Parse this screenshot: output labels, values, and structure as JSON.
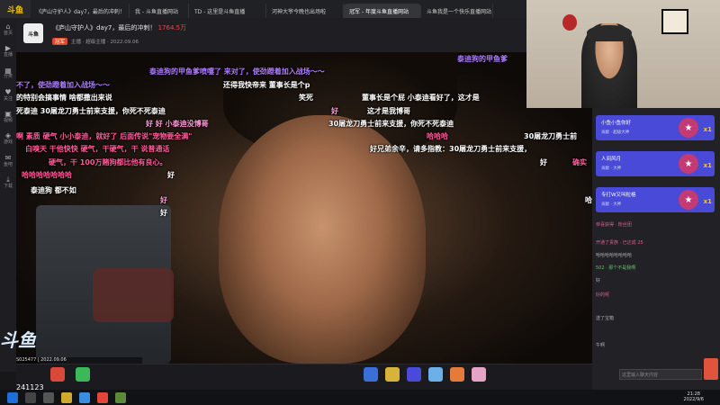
{
  "tabs": [
    {
      "label": "斗鱼",
      "active": false
    },
    {
      "label": "《庐山守护人》day7，最后的冲刺！",
      "active": false
    },
    {
      "label": "我 - 斗鱼直播网站",
      "active": false
    },
    {
      "label": "TD - 这里是斗鱼直播",
      "active": false
    },
    {
      "label": "河神大爷今晚也出场啦",
      "active": false
    },
    {
      "label": "冠军 - 年度斗鱼直播网站",
      "active": true
    },
    {
      "label": "斗鱼我是一个快乐直播网站",
      "active": false
    }
  ],
  "sidebar": {
    "items": [
      {
        "label": "斗鱼",
        "icon": "logo-icon"
      },
      {
        "label": "首页",
        "icon": "home-icon"
      },
      {
        "label": "直播",
        "icon": "live-icon"
      },
      {
        "label": "分类",
        "icon": "category-icon"
      },
      {
        "label": "关注",
        "icon": "follow-icon"
      },
      {
        "label": "视频",
        "icon": "video-icon"
      },
      {
        "label": "游戏",
        "icon": "game-icon"
      },
      {
        "label": "鱼吧",
        "icon": "fishbar-icon"
      },
      {
        "label": "下载",
        "icon": "download-icon"
      }
    ]
  },
  "room": {
    "avatar_text": "斗鱼",
    "title": "《庐山守护人》day7，最后的冲刺！",
    "hot_value": "1764.5万",
    "rank_badge": "冠军",
    "subinfo": "主播 · 超级主播 · 2022.09.06"
  },
  "danmu": [
    {
      "text": "泰迪狗的甲鱼爹喷嚏了 来对了，使劲蹬着加入战场～～",
      "color": "#b07cff"
    },
    {
      "text": "泰迪狗的甲鱼爹",
      "color": "#b07cff"
    },
    {
      "text": "不了，使劲蹬着加入战场～～",
      "color": "#b07cff"
    },
    {
      "text": "还得我快帝来  董事长是个p",
      "color": "#ffffff"
    },
    {
      "text": "的特别会搞事情  啥都撒出来说",
      "color": "#ffffff"
    },
    {
      "text": "笑死",
      "color": "#ffffff"
    },
    {
      "text": "董事长是个屁  小泰迪看好了，这才是",
      "color": "#ffffff"
    },
    {
      "text": "死泰迪   30屠龙刀勇士前来支援，你死不死泰迪",
      "color": "#ffffff"
    },
    {
      "text": "好",
      "color": "#ff9ad8"
    },
    {
      "text": "这才是我博哥",
      "color": "#ffffff"
    },
    {
      "text": "好  好  小泰迪没博哥",
      "color": "#ff9ad8"
    },
    {
      "text": "30屠龙刀勇士前来支援，你死不死泰迪",
      "color": "#ffffff"
    },
    {
      "text": "啊      素质        硬气   小小泰迪，就好了  后面传说\"宠物要全满\"",
      "color": "#ff5a9a"
    },
    {
      "text": "哈哈哈",
      "color": "#ff5a9a"
    },
    {
      "text": "30屠龙刀勇士前",
      "color": "#ffffff"
    },
    {
      "text": "白嗅天       干他快快        硬气，干硬气，干  说普通话",
      "color": "#ff5a9a"
    },
    {
      "text": "好兄弟余辛，请多指教：30屠龙刀勇士前来支援，",
      "color": "#ffffff"
    },
    {
      "text": "硬气，干  100万赌狗都比他有良心。",
      "color": "#ff5a9a"
    },
    {
      "text": "好",
      "color": "#ffffff"
    },
    {
      "text": "确实",
      "color": "#ff5a9a"
    },
    {
      "text": "哈哈哈哈哈哈哈",
      "color": "#ff5a9a"
    },
    {
      "text": "好",
      "color": "#ffffff"
    },
    {
      "text": "泰迪狗  都不如",
      "color": "#ffffff"
    },
    {
      "text": "好",
      "color": "#ff9ad8"
    },
    {
      "text": "好",
      "color": "#ffffff"
    },
    {
      "text": "哈",
      "color": "#ffffff"
    }
  ],
  "video_strip": "S025477 | 2022.09.06",
  "viewer_count": "241123",
  "ranking": [
    {
      "name": "小鱼小鱼你好",
      "sub": "贡献 · 超级大神",
      "mult": "x1"
    },
    {
      "name": "人间风月",
      "sub": "贡献 · 大神",
      "mult": "x1"
    },
    {
      "name": "专打W又叫粒格",
      "sub": "贡献 · 大神",
      "mult": "x1"
    }
  ],
  "chat": [
    {
      "text": "恭喜获得 · 粉丝团",
      "color": "pink"
    },
    {
      "text": "开通了贵族 · 已达成 25",
      "color": "pink"
    },
    {
      "text": "哈哈哈哈哈哈哈哈",
      "color": "gray"
    },
    {
      "text": "502 · 那个不是我啊",
      "color": "green"
    },
    {
      "text": "好",
      "color": "gray"
    },
    {
      "text": "好的呢",
      "color": "pink"
    },
    {
      "text": "送了宝箱",
      "color": "gray"
    },
    {
      "text": "牛啊",
      "color": "gray"
    }
  ],
  "chat_input": {
    "placeholder": "这里输入聊天内容"
  },
  "taskbar_clock": {
    "time": "21:28",
    "date": "2022/9/6"
  }
}
